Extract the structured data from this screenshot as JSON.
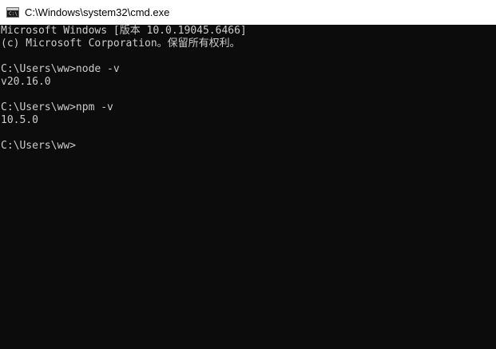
{
  "window": {
    "title": "C:\\Windows\\system32\\cmd.exe",
    "icon": "cmd-icon",
    "icon_glyph": "C:\\",
    "colors": {
      "titlebar_bg": "#ffffff",
      "console_bg": "#0c0c0c",
      "console_text": "#cccccc"
    }
  },
  "console": {
    "lines": [
      "Microsoft Windows [版本 10.0.19045.6466]",
      "(c) Microsoft Corporation。保留所有权利。",
      "",
      "C:\\Users\\ww>node -v",
      "v20.16.0",
      "",
      "C:\\Users\\ww>npm -v",
      "10.5.0",
      "",
      "C:\\Users\\ww>"
    ]
  }
}
